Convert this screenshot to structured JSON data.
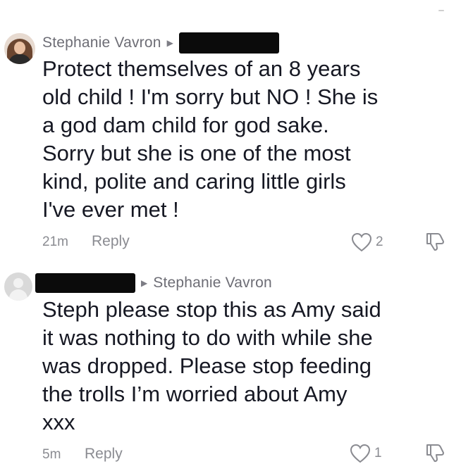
{
  "comments": [
    {
      "username": "Stephanie Vavron",
      "text": "Protect themselves of an 8 years\nold child ! I'm sorry but NO ! She is\na god dam child for god sake.\nSorry but she is one of the most\nkind, polite and caring little girls\nI've ever met !",
      "time": "21m",
      "reply_label": "Reply",
      "likes": "2"
    },
    {
      "reply_to": "Stephanie Vavron",
      "text": "Steph please stop this as Amy said\nit was nothing to do with while she\nwas dropped. Please stop feeding\nthe trolls I’m worried about Amy\nxxx",
      "time": "5m",
      "reply_label": "Reply",
      "likes": "1"
    }
  ]
}
